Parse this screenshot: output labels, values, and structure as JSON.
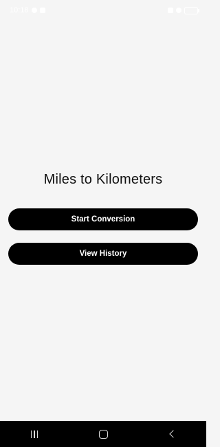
{
  "status_bar": {
    "time": "10:18"
  },
  "main": {
    "title": "Miles to Kilometers",
    "start_button_label": "Start Conversion",
    "history_button_label": "View History"
  },
  "colors": {
    "background": "#f5f5f5",
    "button": "#000000",
    "button_text": "#ffffff",
    "nav_bar": "#000000"
  },
  "icons": [
    "notification-icon",
    "wifi-icon",
    "signal-icon",
    "battery-icon",
    "recent-apps-icon",
    "home-icon",
    "back-icon"
  ]
}
